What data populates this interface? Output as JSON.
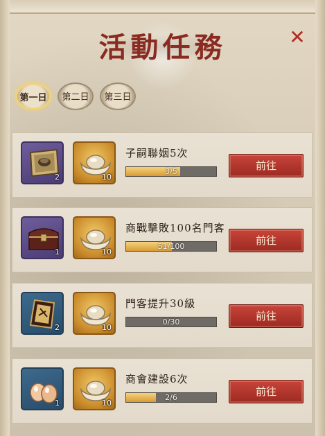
{
  "title": "活動任務",
  "close_glyph": "✕",
  "day_tabs": [
    {
      "label": "第一日",
      "active": true
    },
    {
      "label": "第二日",
      "active": false
    },
    {
      "label": "第三日",
      "active": false
    }
  ],
  "tasks": [
    {
      "name": "子嗣聯姻5次",
      "progress_text": "3/5",
      "progress": 0.6,
      "reward1": {
        "icon": "seal-plate-icon",
        "count": "2"
      },
      "reward2": {
        "icon": "gold-ingot-icon",
        "count": "10"
      },
      "go_label": "前往"
    },
    {
      "name": "商戰擊敗100名門客",
      "progress_text": "51/100",
      "progress": 0.51,
      "reward1": {
        "icon": "treasure-chest-icon",
        "count": "1"
      },
      "reward2": {
        "icon": "gold-ingot-icon",
        "count": "10"
      },
      "go_label": "前往"
    },
    {
      "name": "門客提升30級",
      "progress_text": "0/30",
      "progress": 0,
      "reward1": {
        "icon": "edict-scroll-icon",
        "count": "2"
      },
      "reward2": {
        "icon": "gold-ingot-icon",
        "count": "10"
      },
      "go_label": "前往"
    },
    {
      "name": "商會建設6次",
      "progress_text": "2/6",
      "progress": 0.333,
      "reward1": {
        "icon": "eggs-icon",
        "count": "1"
      },
      "reward2": {
        "icon": "gold-ingot-icon",
        "count": "10"
      },
      "go_label": "前往"
    }
  ],
  "colors": {
    "title": "#8a2b22",
    "button": "#b8362d",
    "bar_fill": "#e8b451",
    "bar_bg": "#6f6b66"
  }
}
